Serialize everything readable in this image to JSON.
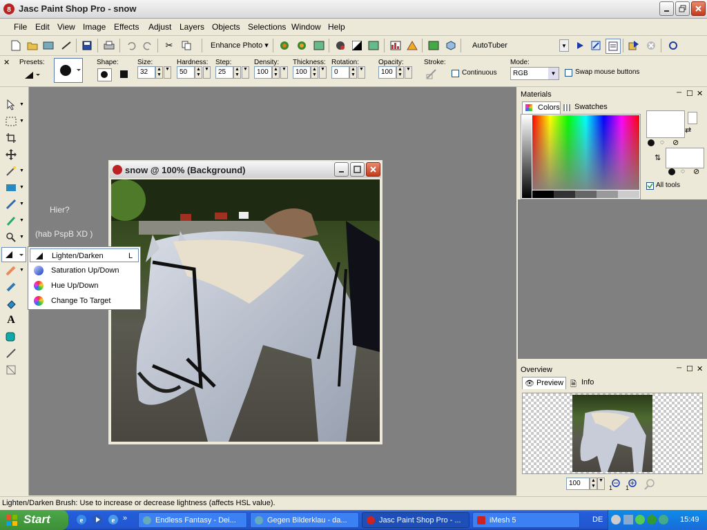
{
  "window": {
    "title": "Jasc Paint Shop Pro - snow"
  },
  "menubar": {
    "items": [
      "File",
      "Edit",
      "View",
      "Image",
      "Effects",
      "Adjust",
      "Layers",
      "Objects",
      "Selections",
      "Window",
      "Help"
    ]
  },
  "toolbar1": {
    "enhance_label": "Enhance Photo",
    "script_select": "AutoTuber"
  },
  "tool_options": {
    "presets_label": "Presets:",
    "shape_label": "Shape:",
    "size_label": "Size:",
    "size_value": "32",
    "hardness_label": "Hardness:",
    "hardness_value": "50",
    "step_label": "Step:",
    "step_value": "25",
    "density_label": "Density:",
    "density_value": "100",
    "thickness_label": "Thickness:",
    "thickness_value": "100",
    "rotation_label": "Rotation:",
    "rotation_value": "0",
    "opacity_label": "Opacity:",
    "opacity_value": "100",
    "stroke_label": "Stroke:",
    "continuous_label": "Continuous",
    "mode_label": "Mode:",
    "mode_value": "RGB",
    "swap_label": "Swap mouse buttons"
  },
  "workspace_text": {
    "line1": "Hier?",
    "line2": "(hab PspB XD )"
  },
  "image_window": {
    "title": "snow @ 100% (Background)"
  },
  "flyout": {
    "items": [
      {
        "label": "Lighten/Darken",
        "shortcut": "L",
        "icon": "lighten-darken-icon"
      },
      {
        "label": "Saturation Up/Down",
        "shortcut": "",
        "icon": "saturation-icon"
      },
      {
        "label": "Hue Up/Down",
        "shortcut": "",
        "icon": "hue-icon"
      },
      {
        "label": "Change To Target",
        "shortcut": "",
        "icon": "change-target-icon"
      }
    ]
  },
  "materials": {
    "title": "Materials",
    "tab_colors": "Colors",
    "tab_swatches": "Swatches",
    "all_tools": "All tools"
  },
  "overview": {
    "title": "Overview",
    "tab_preview": "Preview",
    "tab_info": "Info",
    "zoom_value": "100"
  },
  "status": {
    "text": "Lighten/Darken Brush: Use to increase or decrease lightness (affects HSL value)."
  },
  "taskbar": {
    "start_label": "Start",
    "tasks": [
      "Endless Fantasy - Dei...",
      "Gegen Bilderklau - da...",
      "Jasc Paint Shop Pro - ...",
      "iMesh 5"
    ],
    "lang": "DE",
    "time": "15:49"
  }
}
